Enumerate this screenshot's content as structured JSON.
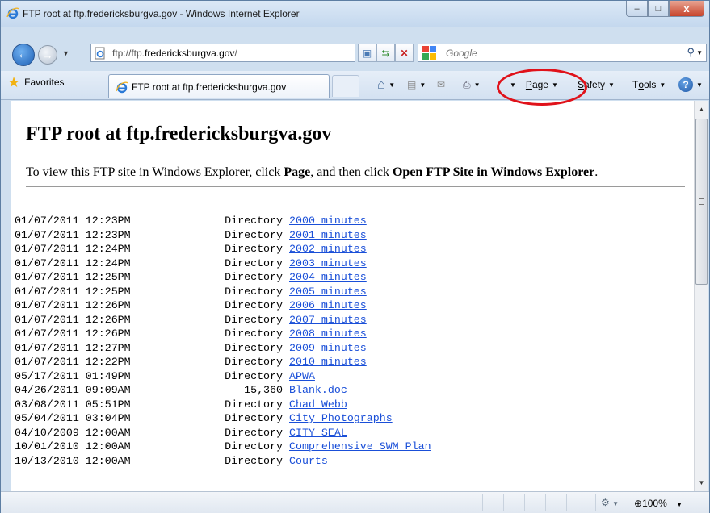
{
  "window": {
    "title": "FTP root at ftp.fredericksburgva.gov - Windows Internet Explorer",
    "minimize_label": "–",
    "maximize_label": "□",
    "close_label": "x"
  },
  "address": {
    "prefix": "ftp://ftp.",
    "host": "fredericksburgva.gov",
    "suffix": "/"
  },
  "search": {
    "placeholder": "Google"
  },
  "favorites": {
    "label": "Favorites"
  },
  "tab": {
    "label": "FTP root at ftp.fredericksburgva.gov"
  },
  "command_bar": {
    "page_first": "P",
    "page_rest": "age",
    "safety_first": "S",
    "safety_rest": "afety",
    "tools_first": "T",
    "tools_mid": "o",
    "tools_rest": "ols"
  },
  "page": {
    "title": "FTP root at ftp.fredericksburgva.gov",
    "instruction_prefix": "To view this FTP site in Windows Explorer, click ",
    "instruction_page": "Page",
    "instruction_mid": ", and then click ",
    "instruction_open": "Open FTP Site in Windows Explorer",
    "instruction_end": "."
  },
  "listing": [
    {
      "date": "01/07/2011 12:23PM",
      "size": "Directory",
      "name": "2000 minutes"
    },
    {
      "date": "01/07/2011 12:23PM",
      "size": "Directory",
      "name": "2001 minutes"
    },
    {
      "date": "01/07/2011 12:24PM",
      "size": "Directory",
      "name": "2002 minutes"
    },
    {
      "date": "01/07/2011 12:24PM",
      "size": "Directory",
      "name": "2003 minutes"
    },
    {
      "date": "01/07/2011 12:25PM",
      "size": "Directory",
      "name": "2004 minutes"
    },
    {
      "date": "01/07/2011 12:25PM",
      "size": "Directory",
      "name": "2005 minutes"
    },
    {
      "date": "01/07/2011 12:26PM",
      "size": "Directory",
      "name": "2006 minutes"
    },
    {
      "date": "01/07/2011 12:26PM",
      "size": "Directory",
      "name": "2007 minutes"
    },
    {
      "date": "01/07/2011 12:26PM",
      "size": "Directory",
      "name": "2008 minutes"
    },
    {
      "date": "01/07/2011 12:27PM",
      "size": "Directory",
      "name": "2009 minutes"
    },
    {
      "date": "01/07/2011 12:22PM",
      "size": "Directory",
      "name": "2010 minutes"
    },
    {
      "date": "05/17/2011 01:49PM",
      "size": "Directory",
      "name": "APWA"
    },
    {
      "date": "04/26/2011 09:09AM",
      "size": "15,360",
      "name": "Blank.doc"
    },
    {
      "date": "03/08/2011 05:51PM",
      "size": "Directory",
      "name": "Chad Webb"
    },
    {
      "date": "05/04/2011 03:04PM",
      "size": "Directory",
      "name": "City Photographs"
    },
    {
      "date": "04/10/2009 12:00AM",
      "size": "Directory",
      "name": "CITY SEAL"
    },
    {
      "date": "10/01/2010 12:00AM",
      "size": "Directory",
      "name": "Comprehensive SWM Plan"
    },
    {
      "date": "10/13/2010 12:00AM",
      "size": "Directory",
      "name": "Courts"
    }
  ],
  "status": {
    "zoom": "100%"
  },
  "colors": {
    "link": "#1a4fd8",
    "highlight": "#e0121a"
  }
}
